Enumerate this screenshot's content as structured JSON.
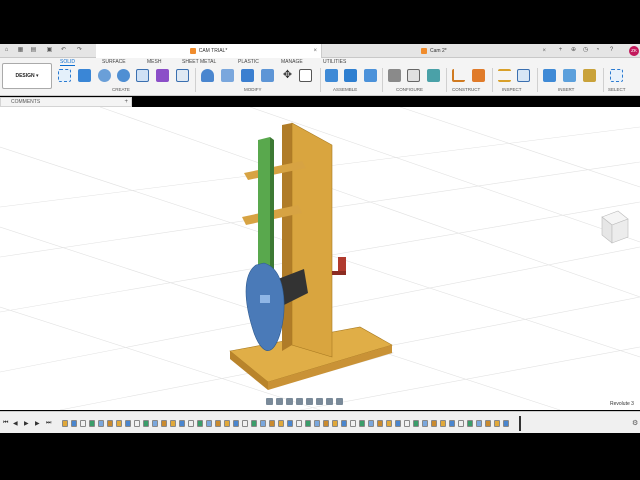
{
  "tabs": {
    "active": "CAM TRIAL*",
    "second": "Cam 2*"
  },
  "workspace": {
    "mode": "DESIGN"
  },
  "ws_tabs": [
    "SOLID",
    "SURFACE",
    "MESH",
    "SHEET METAL",
    "PLASTIC",
    "MANAGE",
    "UTILITIES"
  ],
  "groups": [
    "CREATE",
    "MODIFY",
    "ASSEMBLE",
    "CONFIGURE",
    "CONSTRUCT",
    "INSPECT",
    "INSERT",
    "SELECT"
  ],
  "browser": {
    "comments": "COMMENTS"
  },
  "status": {
    "feature": "Revolute 3"
  },
  "user": {
    "initials": "ZK"
  },
  "colors": {
    "wood": "#d6a33a",
    "arm": "#59a84d",
    "cam": "#4a7ab8",
    "handle": "#b03a2e",
    "accent": "#0a6ccf"
  }
}
